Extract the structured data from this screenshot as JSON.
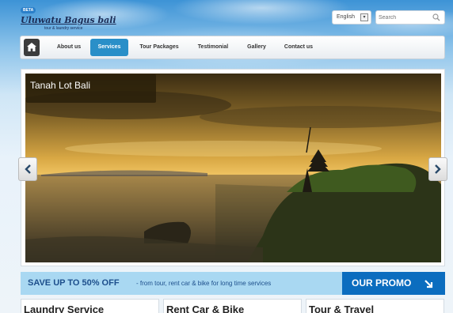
{
  "brand": {
    "badge": "BETA",
    "title": "Uluwatu Bagus bali",
    "subtitle": "tour & laundry service"
  },
  "header": {
    "language": "English",
    "search_placeholder": "Search"
  },
  "nav": {
    "items": [
      {
        "label": "About us"
      },
      {
        "label": "Services"
      },
      {
        "label": "Tour Packages"
      },
      {
        "label": "Testimonial"
      },
      {
        "label": "Gallery"
      },
      {
        "label": "Contact us"
      }
    ],
    "active": "Services"
  },
  "slider": {
    "caption": "Tanah Lot Bali"
  },
  "promo": {
    "headline": "SAVE UP TO 50% OFF",
    "detail": "- from tour, rent car & bike for long time services",
    "button": "OUR PROMO"
  },
  "cards": [
    {
      "title": "Laundry Service"
    },
    {
      "title": "Rent Car & Bike"
    },
    {
      "title": "Tour & Travel"
    }
  ],
  "colors": {
    "accent": "#2a8fc8",
    "promo_button": "#0b6dbf",
    "promo_band": "#a9d8f2",
    "brand_text": "#1c2c55"
  }
}
